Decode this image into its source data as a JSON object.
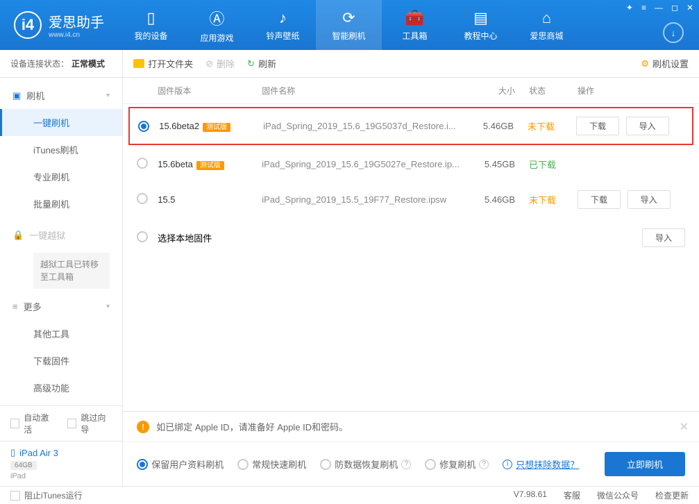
{
  "header": {
    "title": "爱思助手",
    "subtitle": "www.i4.cn",
    "tabs": [
      {
        "label": "我的设备"
      },
      {
        "label": "应用游戏"
      },
      {
        "label": "铃声壁纸"
      },
      {
        "label": "智能刷机"
      },
      {
        "label": "工具箱"
      },
      {
        "label": "教程中心"
      },
      {
        "label": "爱思商城"
      }
    ]
  },
  "status": {
    "label": "设备连接状态：",
    "value": "正常模式"
  },
  "toolbar": {
    "open_folder": "打开文件夹",
    "delete": "删除",
    "refresh": "刷新",
    "settings": "刷机设置"
  },
  "sidebar": {
    "flash_group": "刷机",
    "items": [
      "一键刷机",
      "iTunes刷机",
      "专业刷机",
      "批量刷机"
    ],
    "jailbreak": "一键越狱",
    "jailbreak_note": "越狱工具已转移至工具箱",
    "more_group": "更多",
    "more_items": [
      "其他工具",
      "下载固件",
      "高级功能"
    ]
  },
  "table": {
    "headers": {
      "ver": "固件版本",
      "name": "固件名称",
      "size": "大小",
      "status": "状态",
      "action": "操作"
    },
    "rows": [
      {
        "ver": "15.6beta2",
        "beta": "测试版",
        "name": "iPad_Spring_2019_15.6_19G5037d_Restore.i...",
        "size": "5.46GB",
        "status": "未下载",
        "status_cls": "not",
        "checked": true,
        "download": "下载",
        "import": "导入"
      },
      {
        "ver": "15.6beta",
        "beta": "测试版",
        "name": "iPad_Spring_2019_15.6_19G5027e_Restore.ip...",
        "size": "5.45GB",
        "status": "已下载",
        "status_cls": "done",
        "checked": false
      },
      {
        "ver": "15.5",
        "beta": "",
        "name": "iPad_Spring_2019_15.5_19F77_Restore.ipsw",
        "size": "5.46GB",
        "status": "未下载",
        "status_cls": "not",
        "checked": false,
        "download": "下载",
        "import": "导入"
      }
    ],
    "local_row": "选择本地固件",
    "local_import": "导入"
  },
  "side_bottom": {
    "auto_activate": "自动激活",
    "skip_guide": "跳过向导",
    "device_name": "iPad Air 3",
    "device_storage": "64GB",
    "device_type": "iPad"
  },
  "bottom": {
    "warning": "如已绑定 Apple ID，请准备好 Apple ID和密码。",
    "opts": [
      "保留用户资料刷机",
      "常规快速刷机",
      "防数据恢复刷机",
      "修复刷机"
    ],
    "erase_link": "只想抹除数据？",
    "flash_button": "立即刷机"
  },
  "footer": {
    "block_itunes": "阻止iTunes运行",
    "version": "V7.98.61",
    "service": "客服",
    "wechat": "微信公众号",
    "update": "检查更新"
  }
}
